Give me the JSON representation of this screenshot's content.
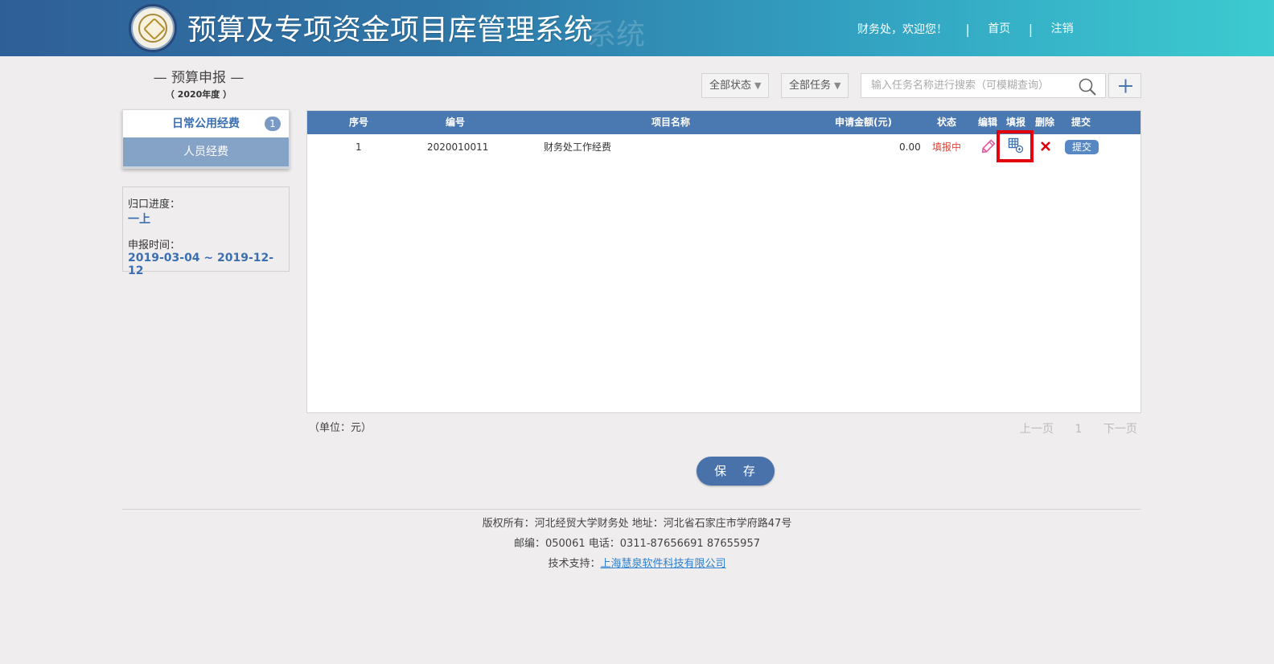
{
  "header": {
    "title": "预算及专项资金项目库管理系统",
    "title_ghost": "系统",
    "welcome": "财务处，欢迎您！",
    "home_link": "首页",
    "logout_link": "注销",
    "separator": "|"
  },
  "sidebar": {
    "section_title": "— 预算申报 —",
    "year": "（ 2020年度 ）",
    "menu": [
      {
        "label": "日常公用经费",
        "badge": "1"
      },
      {
        "label": "人员经费"
      }
    ],
    "info": {
      "progress_label": "归口进度：",
      "progress_value": "一上",
      "time_label": "申报时间：",
      "time_value": "2019-03-04 ~ 2019-12-12"
    }
  },
  "toolbar": {
    "status_filter": "全部状态",
    "task_filter": "全部任务",
    "search_placeholder": "输入任务名称进行搜索（可模糊查询）",
    "add_icon": "plus-icon"
  },
  "table": {
    "columns": [
      "序号",
      "编号",
      "项目名称",
      "申请金额(元)",
      "状态",
      "编辑",
      "填报",
      "删除",
      "提交"
    ],
    "rows": [
      {
        "index": "1",
        "code": "2020010011",
        "name": "财务处工作经费",
        "amount": "0.00",
        "status": "填报中",
        "submit_label": "提交"
      }
    ],
    "icons": {
      "edit": "pencil-icon",
      "fill": "form-table-icon",
      "delete": "close-x-icon"
    }
  },
  "unit_note": "（单位：元）",
  "pager": {
    "prev": "上一页",
    "current": "1",
    "next": "下一页"
  },
  "save_label": "保 存",
  "footer": {
    "line1": "版权所有：河北经贸大学财务处 地址：河北省石家庄市学府路47号",
    "line2": "邮编：050061 电话：0311-87656691 87655957",
    "support_label": "技术支持：",
    "support_link": "上海慧泉软件科技有限公司"
  },
  "colors": {
    "header_start": "#2f5f97",
    "header_end": "#3ccbd0",
    "accent": "#4a78b0",
    "status": "#e0463a",
    "highlight": "#e3000f"
  }
}
